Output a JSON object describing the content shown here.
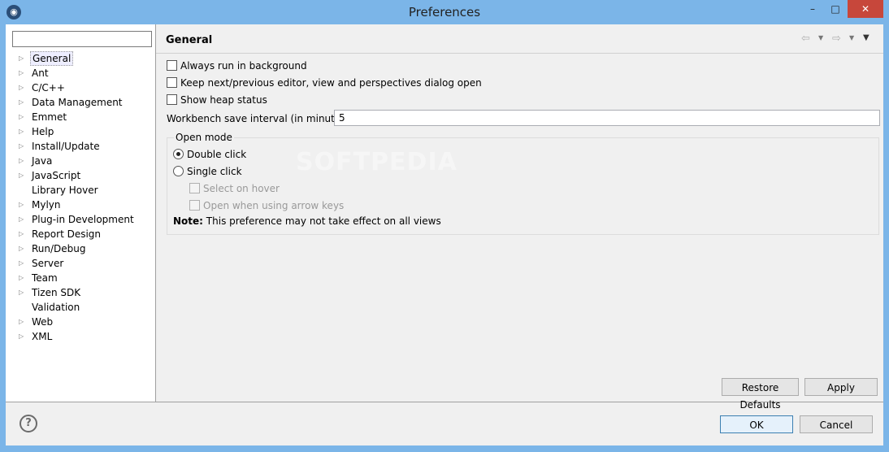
{
  "window": {
    "title": "Preferences",
    "app_icon": "eclipse-icon",
    "minimize_glyph": "–",
    "maximize_glyph": "□",
    "close_glyph": "✕"
  },
  "tree": {
    "filter_value": "",
    "items": [
      {
        "label": "General",
        "expandable": true,
        "selected": true
      },
      {
        "label": "Ant",
        "expandable": true
      },
      {
        "label": "C/C++",
        "expandable": true
      },
      {
        "label": "Data Management",
        "expandable": true
      },
      {
        "label": "Emmet",
        "expandable": true
      },
      {
        "label": "Help",
        "expandable": true
      },
      {
        "label": "Install/Update",
        "expandable": true
      },
      {
        "label": "Java",
        "expandable": true
      },
      {
        "label": "JavaScript",
        "expandable": true
      },
      {
        "label": "Library Hover",
        "expandable": false
      },
      {
        "label": "Mylyn",
        "expandable": true
      },
      {
        "label": "Plug-in Development",
        "expandable": true
      },
      {
        "label": "Report Design",
        "expandable": true
      },
      {
        "label": "Run/Debug",
        "expandable": true
      },
      {
        "label": "Server",
        "expandable": true
      },
      {
        "label": "Team",
        "expandable": true
      },
      {
        "label": "Tizen SDK",
        "expandable": true
      },
      {
        "label": "Validation",
        "expandable": false
      },
      {
        "label": "Web",
        "expandable": true
      },
      {
        "label": "XML",
        "expandable": true
      }
    ],
    "expand_glyph": "▷"
  },
  "page": {
    "title": "General",
    "back_glyph": "⇦",
    "forward_glyph": "⇨",
    "dropdown_glyph": "▼",
    "menu_glyph": "▼",
    "checkboxes": [
      {
        "label": "Always run in background",
        "checked": false
      },
      {
        "label": "Keep next/previous editor, view and perspectives dialog open",
        "checked": false
      },
      {
        "label": "Show heap status",
        "checked": false
      }
    ],
    "interval_label": "Workbench save interval (in minutes):",
    "interval_value": "5",
    "open_mode": {
      "label": "Open mode",
      "double_click": "Double click",
      "single_click": "Single click",
      "selected": "double",
      "select_on_hover": "Select on hover",
      "open_arrow_keys": "Open when using arrow keys",
      "note_label": "Note:",
      "note_text": "This preference may not take effect on all views"
    },
    "restore_defaults": "Restore Defaults",
    "apply": "Apply"
  },
  "footer": {
    "help_glyph": "?",
    "ok": "OK",
    "cancel": "Cancel"
  },
  "watermark": "SOFTPEDIA"
}
